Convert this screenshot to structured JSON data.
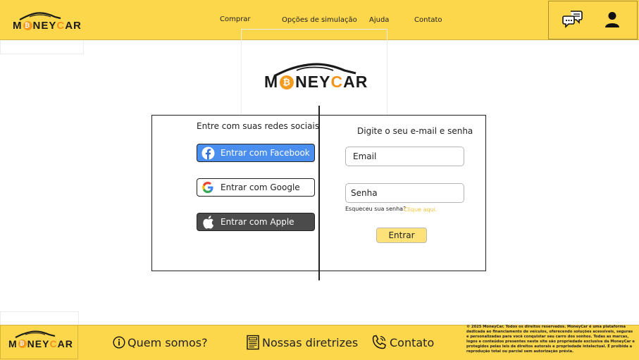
{
  "brand": {
    "prefix": "M",
    "coin": "₿",
    "middle": "NEY",
    "c": "C",
    "suffix": "AR"
  },
  "header": {
    "nav": [
      "Comprar",
      "Opções de simulação",
      "Ajuda",
      "Contato"
    ]
  },
  "login": {
    "social_title": "Entre com suas redes sociais",
    "social_buttons": [
      "Entrar com Facebook",
      "Entrar com Google",
      "Entrar com Apple"
    ],
    "form_title": "Digite o seu e-mail e senha",
    "email_placeholder": "Email",
    "password_placeholder": "Senha",
    "forgot_text": "Esqueceu sua senha?",
    "forgot_link": "Clique aqui.",
    "submit_label": "Entrar"
  },
  "footer": {
    "links": [
      "Quem somos?",
      "Nossas diretrizes",
      "Contato"
    ],
    "legal": "© 2025 MoneyCar. Todos os direitos reservados. MoneyCar é uma plataforma dedicada ao financiamento de veículos, oferecendo soluções acessíveis, seguras e personalizadas para você conquistar seu carro dos sonhos. Todas as marcas, logos e conteúdos presentes neste site são propriedade exclusiva da MoneyCar e protegidos pelas leis de direitos autorais e propriedade intelectual. É proibida a reprodução total ou parcial sem autorização prévia."
  },
  "colors": {
    "brand_yellow": "#fcd64b",
    "coin_orange": "#f39a1f",
    "facebook_blue": "#4a8ef0",
    "apple_gray": "#4b4b4b"
  },
  "icons": [
    "chat-icon",
    "user-icon",
    "facebook-icon",
    "google-icon",
    "apple-icon",
    "info-icon",
    "document-icon",
    "phone-icon",
    "car-icon"
  ]
}
